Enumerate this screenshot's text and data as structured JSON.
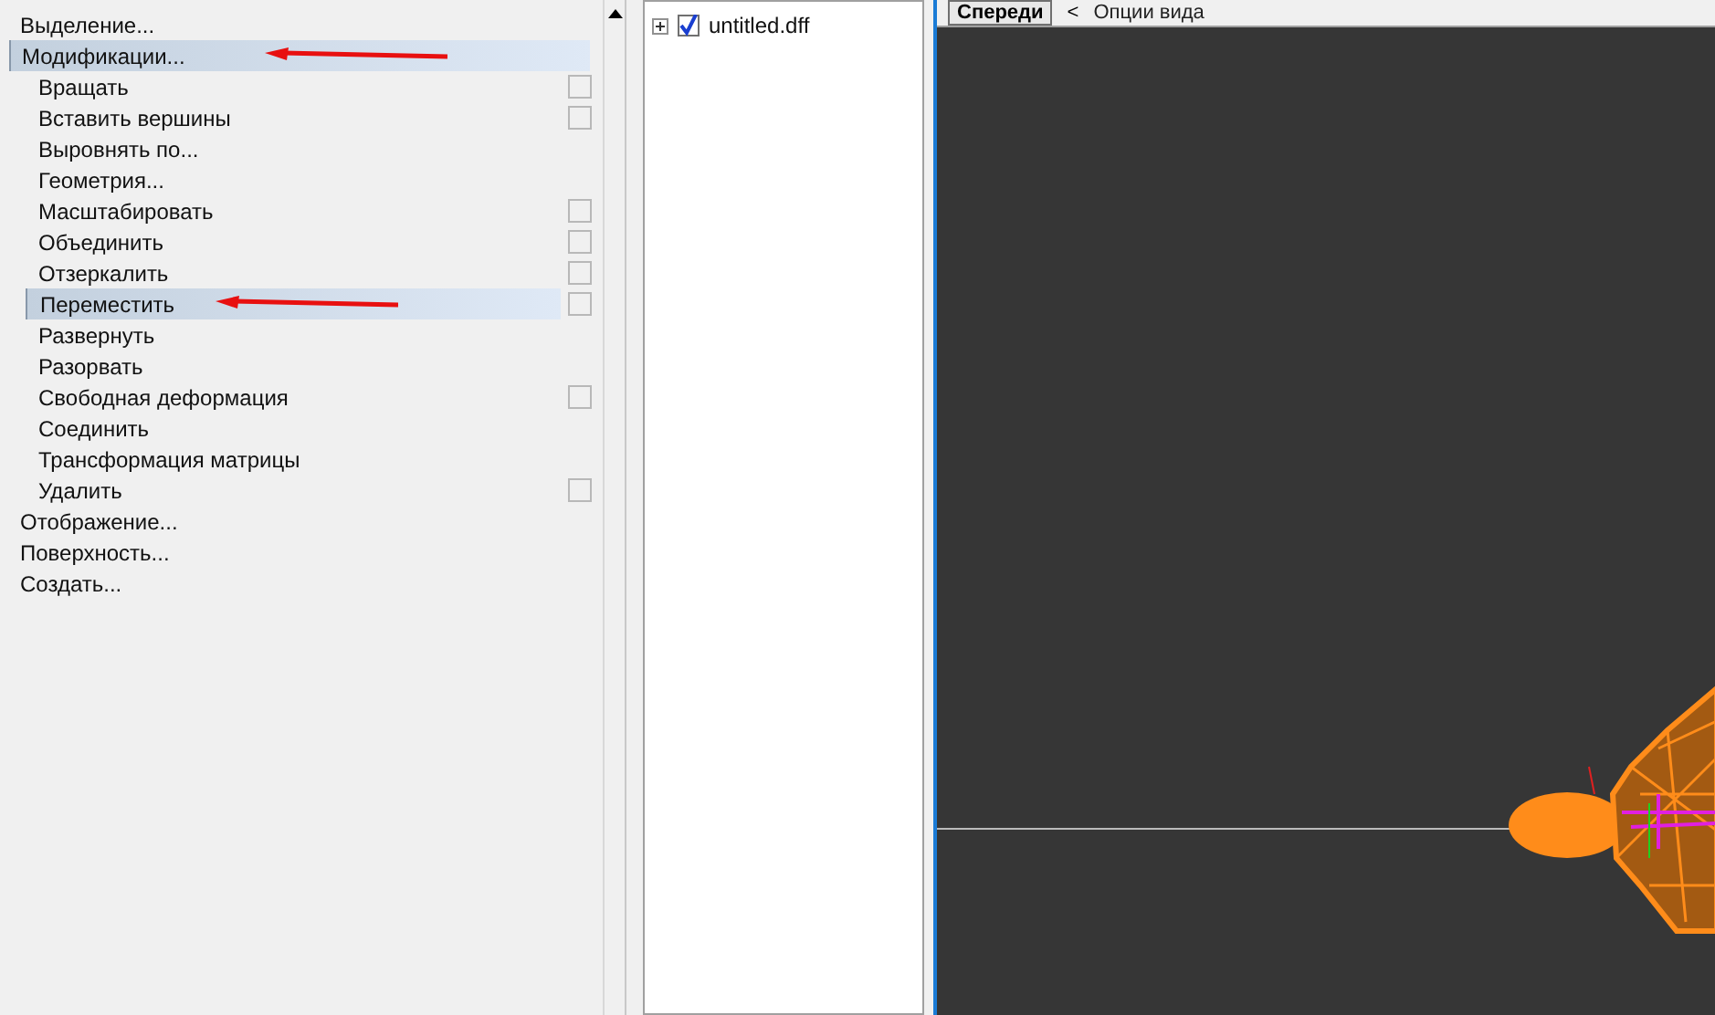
{
  "menu": {
    "items": [
      {
        "label": "Выделение...",
        "kind": "group",
        "selected": false,
        "option_box": false,
        "arrow": false
      },
      {
        "label": "Модификации...",
        "kind": "group",
        "selected": true,
        "option_box": false,
        "arrow": true
      },
      {
        "label": "Вращать",
        "kind": "command",
        "selected": false,
        "option_box": true,
        "arrow": false
      },
      {
        "label": "Вставить вершины",
        "kind": "command",
        "selected": false,
        "option_box": true,
        "arrow": false
      },
      {
        "label": "Выровнять по...",
        "kind": "command",
        "selected": false,
        "option_box": false,
        "arrow": false
      },
      {
        "label": "Геометрия...",
        "kind": "command",
        "selected": false,
        "option_box": false,
        "arrow": false
      },
      {
        "label": "Масштабировать",
        "kind": "command",
        "selected": false,
        "option_box": true,
        "arrow": false
      },
      {
        "label": "Объединить",
        "kind": "command",
        "selected": false,
        "option_box": true,
        "arrow": false
      },
      {
        "label": "Отзеркалить",
        "kind": "command",
        "selected": false,
        "option_box": true,
        "arrow": false
      },
      {
        "label": "Переместить",
        "kind": "command",
        "selected": true,
        "option_box": true,
        "arrow": true
      },
      {
        "label": "Развернуть",
        "kind": "command",
        "selected": false,
        "option_box": false,
        "arrow": false
      },
      {
        "label": "Разорвать",
        "kind": "command",
        "selected": false,
        "option_box": false,
        "arrow": false
      },
      {
        "label": "Свободная деформация",
        "kind": "command",
        "selected": false,
        "option_box": true,
        "arrow": false
      },
      {
        "label": "Соединить",
        "kind": "command",
        "selected": false,
        "option_box": false,
        "arrow": false
      },
      {
        "label": "Трансформация матрицы",
        "kind": "command",
        "selected": false,
        "option_box": false,
        "arrow": false
      },
      {
        "label": "Удалить",
        "kind": "command",
        "selected": false,
        "option_box": true,
        "arrow": false
      },
      {
        "label": "Отображение...",
        "kind": "group",
        "selected": false,
        "option_box": false,
        "arrow": false
      },
      {
        "label": "Поверхность...",
        "kind": "group",
        "selected": false,
        "option_box": false,
        "arrow": false
      },
      {
        "label": "Создать...",
        "kind": "group",
        "selected": false,
        "option_box": false,
        "arrow": false
      }
    ]
  },
  "tree": {
    "items": [
      {
        "label": "untitled.dff",
        "checked": true,
        "expanded": false
      }
    ]
  },
  "viewport": {
    "view_button": "Спереди",
    "options_arrow": "<",
    "options_label": "Опции вида"
  }
}
